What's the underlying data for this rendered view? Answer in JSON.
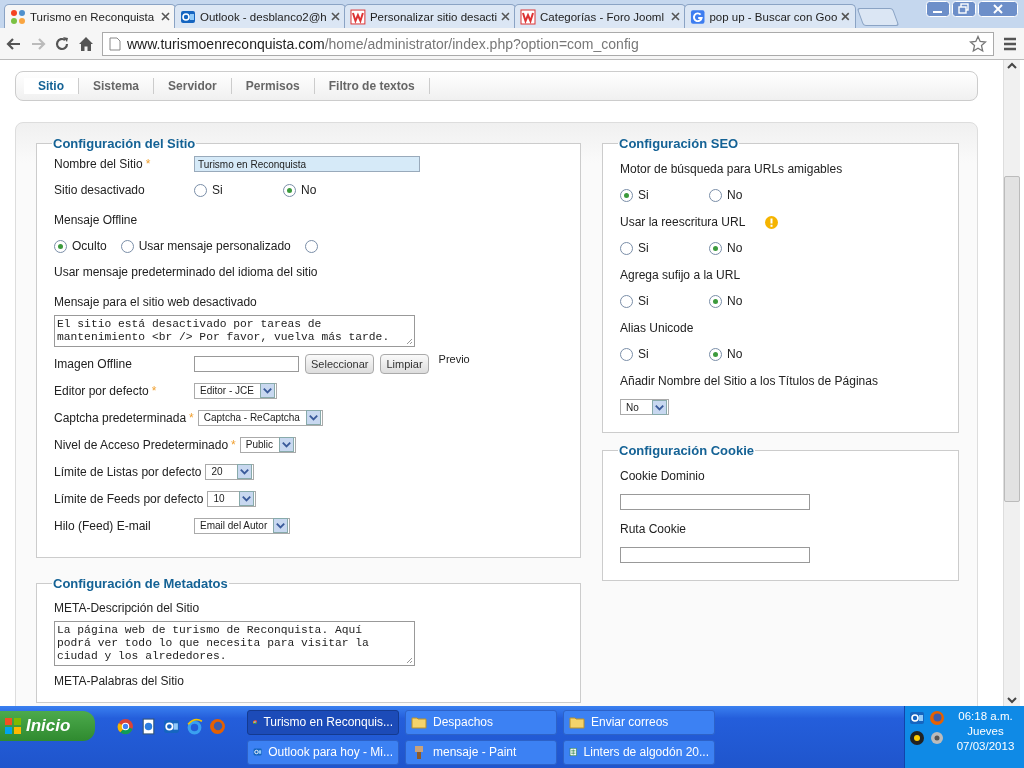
{
  "browser": {
    "tabs": [
      {
        "title": "Turismo en Reconquista",
        "selected": true
      },
      {
        "title": "Outlook - desblanco2@h",
        "selected": false
      },
      {
        "title": "Personalizar sitio desacti",
        "selected": false
      },
      {
        "title": "Categorías - Foro Jooml",
        "selected": false
      },
      {
        "title": "pop up - Buscar con Goo",
        "selected": false
      }
    ],
    "url": {
      "domain": "www.turismoenreconquista.com",
      "path": "/home/administrator/index.php?option=com_config"
    }
  },
  "subtabs": [
    {
      "label": "Sitio",
      "selected": true
    },
    {
      "label": "Sistema",
      "selected": false
    },
    {
      "label": "Servidor",
      "selected": false
    },
    {
      "label": "Permisos",
      "selected": false
    },
    {
      "label": "Filtro de textos",
      "selected": false
    }
  ],
  "site_config": {
    "legend": "Configuración del Sitio",
    "fields": [
      {
        "kind": "text",
        "label": "Nombre del Sitio",
        "required_mark": "*",
        "value": "Turismo en Reconquista"
      },
      {
        "kind": "radio",
        "label": "Sitio desactivado",
        "options": [
          {
            "label": "Si",
            "selected": false
          },
          {
            "label": "No",
            "selected": true
          }
        ]
      },
      {
        "kind": "radio_block",
        "label": "Mensaje Offline",
        "options": [
          {
            "label": "Oculto",
            "selected": true
          },
          {
            "label": "Usar mensaje personalizado",
            "selected": false
          },
          {
            "selected": false
          }
        ],
        "note": "Usar mensaje predeterminado del idioma del sitio"
      },
      {
        "kind": "textarea",
        "label": "Mensaje para el sitio web desactivado",
        "value": "El sitio está desactivado por tareas de\nmantenimiento <br /> Por favor, vuelva más tarde."
      },
      {
        "kind": "file",
        "label": "Imagen Offline",
        "buttons": [
          "Seleccionar",
          "Limpiar"
        ],
        "preview": "Previo"
      },
      {
        "kind": "select",
        "label": "Editor por defecto",
        "required_mark": "*",
        "value": "Editor - JCE"
      },
      {
        "kind": "select_inline",
        "label": "Captcha predeterminada",
        "required_mark": "*",
        "value": "Captcha - ReCaptcha"
      },
      {
        "kind": "select_inline",
        "label": "Nivel de Acceso Predeterminado",
        "required_mark": "*",
        "value": "Public"
      },
      {
        "kind": "select_inline",
        "label": "Límite de Listas por defecto",
        "value": "20"
      },
      {
        "kind": "select_inline",
        "label": "Límite de Feeds por defecto",
        "value": "10"
      },
      {
        "kind": "select",
        "label": "Hilo (Feed) E-mail",
        "value": "Email del Autor"
      }
    ]
  },
  "metadata": {
    "legend": "Configuración de Metadatos",
    "fields": [
      {
        "kind": "textarea",
        "label": "META-Descripción del Sitio",
        "value": "La página web de turismo de Reconquista. Aquí\npodrá ver todo lo que necesita para visitar la\nciudad y los alrededores."
      },
      {
        "kind": "heading",
        "label": "META-Palabras del Sitio"
      }
    ]
  },
  "seo": {
    "legend": "Configuración SEO",
    "fields": [
      {
        "kind": "radio_stacked",
        "label": "Motor de búsqueda para URLs amigables",
        "options": [
          {
            "label": "Si",
            "selected": true
          },
          {
            "label": "No",
            "selected": false
          }
        ]
      },
      {
        "kind": "radio_stacked",
        "label": "Usar la reescritura URL",
        "warning": true,
        "options": [
          {
            "label": "Si",
            "selected": false
          },
          {
            "label": "No",
            "selected": true
          }
        ]
      },
      {
        "kind": "radio_stacked",
        "label": "Agrega sufijo a la URL",
        "options": [
          {
            "label": "Si",
            "selected": false
          },
          {
            "label": "No",
            "selected": true
          }
        ]
      },
      {
        "kind": "radio_stacked",
        "label": "Alias Unicode",
        "options": [
          {
            "label": "Si",
            "selected": false
          },
          {
            "label": "No",
            "selected": true
          }
        ]
      },
      {
        "kind": "select_stacked",
        "label": "Añadir Nombre del Sitio a los Títulos de Páginas",
        "value": "No"
      }
    ]
  },
  "cookie": {
    "legend": "Configuración Cookie",
    "fields": [
      {
        "kind": "text_stacked",
        "label": "Cookie Dominio"
      },
      {
        "kind": "text_stacked",
        "label": "Ruta Cookie"
      }
    ]
  },
  "taskbar": {
    "start": "Inicio",
    "tasks": [
      {
        "label": "Turismo en Reconquis...",
        "selected": true
      },
      {
        "label": "Despachos",
        "selected": false
      },
      {
        "label": "Enviar correos",
        "selected": false
      },
      {
        "label": "Outlook para hoy - Mi...",
        "selected": false
      },
      {
        "label": "mensaje - Paint",
        "selected": false
      },
      {
        "label": "Linters de algodón 20...",
        "selected": false
      }
    ],
    "clock": {
      "time": "06:18 a.m.",
      "day": "Jueves",
      "date": "07/03/2013"
    }
  }
}
